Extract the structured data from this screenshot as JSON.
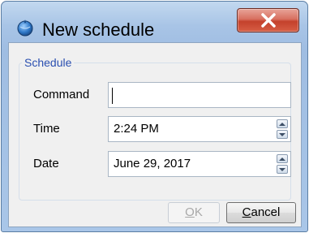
{
  "window": {
    "title": "New schedule",
    "icons": {
      "app": "globe-icon",
      "close": "close-icon"
    }
  },
  "group": {
    "title": "Schedule"
  },
  "fields": {
    "command": {
      "label": "Command",
      "value": ""
    },
    "time": {
      "label": "Time",
      "value": "2:24 PM"
    },
    "date": {
      "label": "Date",
      "value": "June 29, 2017"
    }
  },
  "buttons": {
    "ok": {
      "mnemonic": "O",
      "rest": "K",
      "enabled": false
    },
    "cancel": {
      "mnemonic": "C",
      "rest": "ancel",
      "enabled": true
    }
  },
  "colors": {
    "close_button": "#c4412c",
    "group_title": "#2a4fb0",
    "titlebar": "#a8c4e6"
  }
}
